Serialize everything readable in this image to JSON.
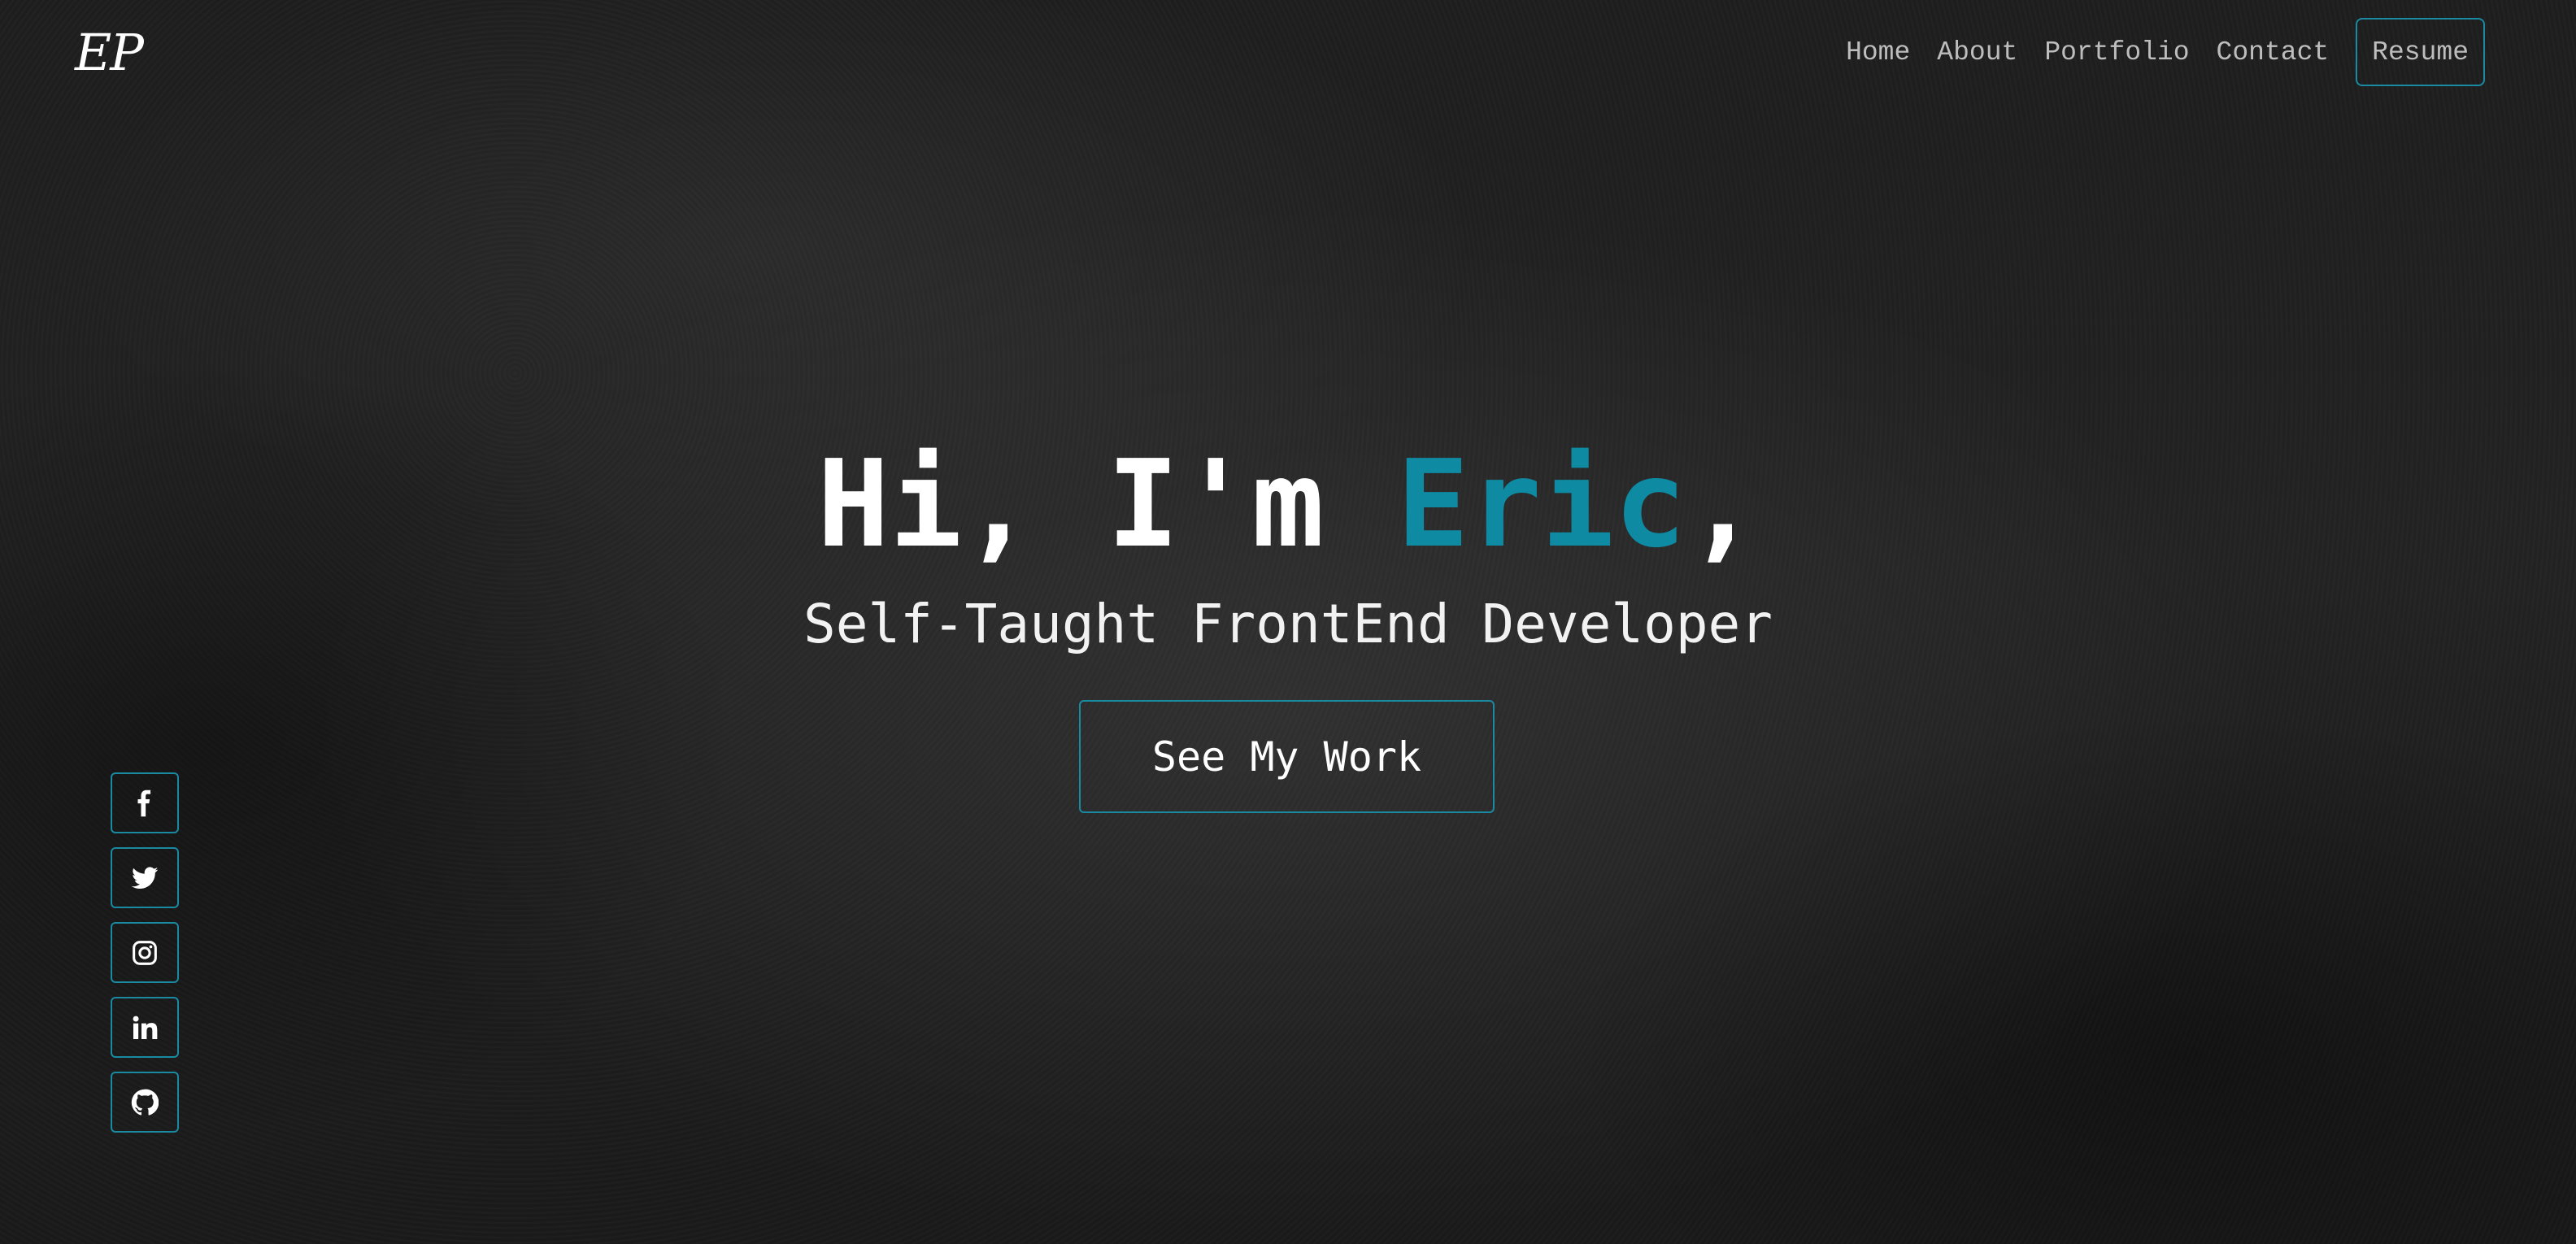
{
  "header": {
    "logo": "EP",
    "nav": [
      {
        "label": "Home"
      },
      {
        "label": "About"
      },
      {
        "label": "Portfolio"
      },
      {
        "label": "Contact"
      }
    ],
    "resume_label": "Resume"
  },
  "hero": {
    "greeting": "Hi, I'm ",
    "name": "Eric",
    "name_suffix": ",",
    "subtitle": "Self-Taught FrontEnd Developer",
    "cta_label": "See My Work"
  },
  "social": [
    {
      "icon": "facebook-icon"
    },
    {
      "icon": "twitter-icon"
    },
    {
      "icon": "instagram-icon"
    },
    {
      "icon": "linkedin-icon"
    },
    {
      "icon": "github-icon"
    }
  ],
  "colors": {
    "accent": "#0f8aa3",
    "border": "#1a8aa2",
    "background": "#1b1b1b",
    "nav_text": "#bdbdbd"
  }
}
